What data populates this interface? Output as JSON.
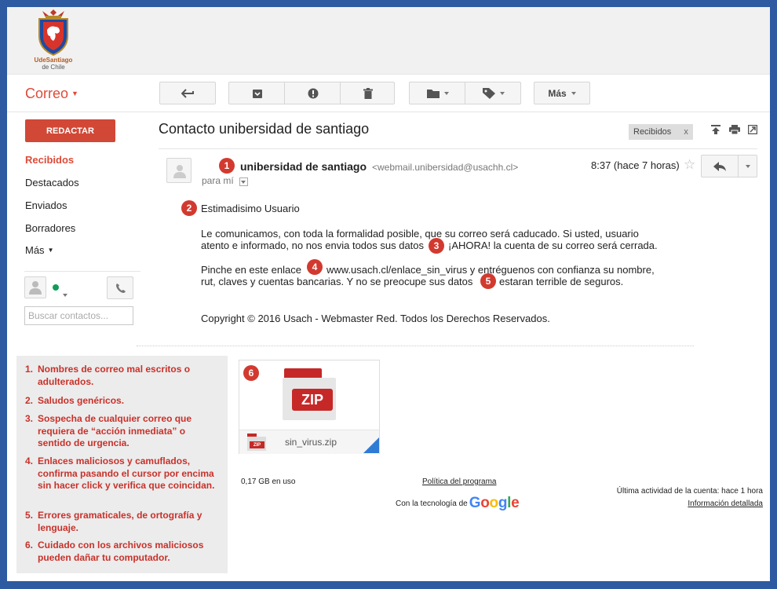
{
  "header": {
    "logo_text_line1": "UdeSantiago",
    "logo_text_line2": "de Chile"
  },
  "app": {
    "title": "Correo"
  },
  "toolbar": {
    "more_label": "Más"
  },
  "sidebar": {
    "compose_label": "REDACTAR",
    "items": [
      {
        "label": "Recibidos",
        "active": true
      },
      {
        "label": "Destacados",
        "active": false
      },
      {
        "label": "Enviados",
        "active": false
      },
      {
        "label": "Borradores",
        "active": false
      },
      {
        "label": "Más",
        "active": false
      }
    ],
    "search_placeholder": "Buscar contactos..."
  },
  "message": {
    "subject": "Contacto unibersidad de santiago",
    "label_chip": "Recibidos",
    "label_close": "x",
    "sender_name": "unibersidad de santiago",
    "sender_email": "<webmail.unibersidad@usachh.cl>",
    "recipient": "para mí",
    "time": "8:37 (hace 7 horas)",
    "greeting": "Estimadisimo Usuario",
    "para1_line1": "Le comunicamos, con toda la formalidad posible, que su correo será caducado. Si usted, usuario",
    "para1_line2a": "atento e informado, no nos envia todos sus datos",
    "para1_line2b": "¡AHORA! la cuenta de su correo será cerrada.",
    "para2_line1a": "Pinche en este enlace",
    "para2_line1b": "www.usach.cl/enlace_sin_virus y entréguenos con confianza su nombre,",
    "para2_line2a": "rut, claves y cuentas bancarias. Y no se preocupe sus datos",
    "para2_line2b": "estaran terrible de seguros.",
    "copyright": "Copyright © 2016 Usach - Webmaster Red. Todos los Derechos Reservados."
  },
  "attachment": {
    "big_label": "ZIP",
    "small_label": "ZIP",
    "filename": "sin_virus.zip"
  },
  "badges": [
    "1",
    "2",
    "3",
    "4",
    "5",
    "6"
  ],
  "footer": {
    "storage": "0,17 GB en uso",
    "policy": "Política del programa",
    "powered_by": "Con la tecnología de",
    "google": "Google",
    "last_activity": "Última actividad de la cuenta: hace 1 hora",
    "details": "Información detallada"
  },
  "tips": [
    {
      "num": "1.",
      "text": "Nombres de correo mal escritos o adulterados."
    },
    {
      "num": "2.",
      "text": "Saludos genéricos."
    },
    {
      "num": "3.",
      "text": "Sospecha de cualquier correo que requiera de “acción inmediata” o sentido de urgencia."
    },
    {
      "num": "4.",
      "text": "Enlaces maliciosos y camuflados, confirma pasando el cursor por encima sin hacer click y verifica que coincidan."
    },
    {
      "num": "5.",
      "text": "Errores gramaticales, de ortografía y lenguaje."
    },
    {
      "num": "6.",
      "text": "Cuidado con los archivos maliciosos pueden dañar tu computador."
    }
  ],
  "colors": {
    "frame_border": "#2d5aa0",
    "accent_red": "#dd4b39",
    "compose_red": "#d14836",
    "badge_red": "#d23a2f",
    "tip_red": "#c8312a",
    "tip_bg": "#ececec",
    "online_green": "#0f9d58"
  },
  "icons": [
    "back-arrow-icon",
    "archive-icon",
    "report-spam-icon",
    "trash-icon",
    "folder-icon",
    "label-tag-icon",
    "print-icon",
    "new-window-icon",
    "star-icon",
    "reply-icon",
    "avatar-icon",
    "phone-icon",
    "zip-file-icon"
  ]
}
